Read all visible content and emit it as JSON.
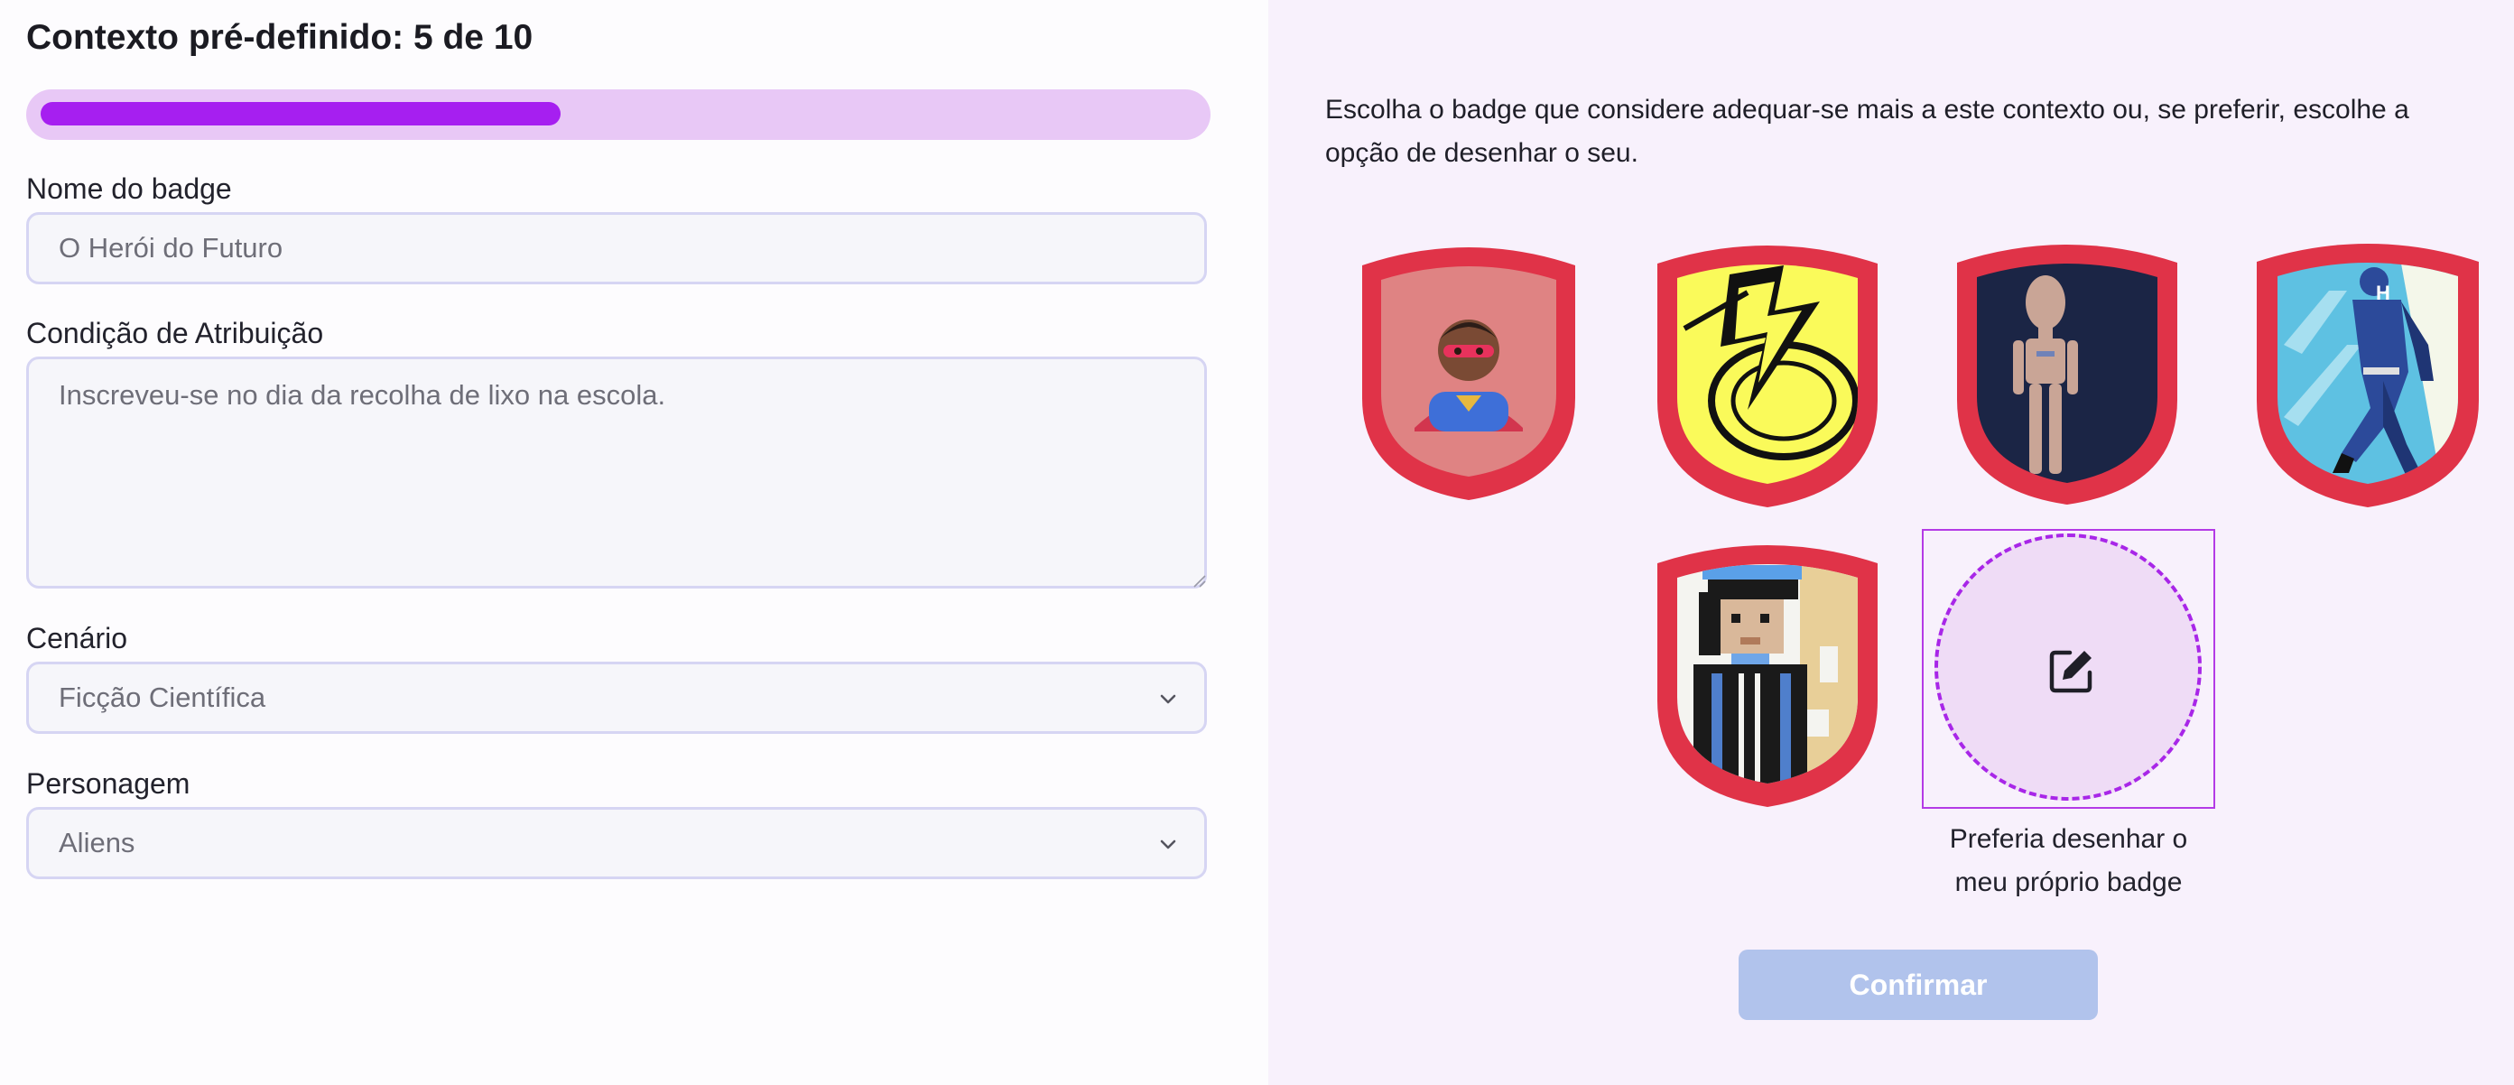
{
  "header": {
    "title": "Contexto pré-definido: 5 de 10",
    "progress": 0.45
  },
  "form": {
    "badge_name": {
      "label": "Nome do badge",
      "value": "O Herói do Futuro"
    },
    "condition": {
      "label": "Condição de Atribuição",
      "value": "Inscreveu-se no dia da recolha de lixo na escola."
    },
    "scenario": {
      "label": "Cenário",
      "value": "Ficção Científica"
    },
    "character": {
      "label": "Personagem",
      "value": "Aliens"
    }
  },
  "panel": {
    "intro": "Escolha o badge que considere adequar-se mais a este contexto ou, se preferir, escolhe a opção de desenhar o seu.",
    "badges": [
      {
        "name": "badge-superhero-emoji",
        "frame_color": "#e03348"
      },
      {
        "name": "badge-lightning-yellow",
        "frame_color": "#e03348"
      },
      {
        "name": "badge-robot-navy",
        "frame_color": "#e03348"
      },
      {
        "name": "badge-hero-blue",
        "frame_color": "#e03348"
      },
      {
        "name": "badge-pixel-astronaut",
        "frame_color": "#e03348"
      }
    ],
    "draw_option": {
      "caption_line1": "Preferia desenhar o",
      "caption_line2": "meu próprio badge",
      "icon": "edit-icon"
    },
    "confirm_label": "Confirmar"
  },
  "colors": {
    "accent": "#a61ff0",
    "progress_track": "#e8c8f6",
    "panel_bg": "#f8f1fc",
    "confirm_disabled": "#b1c3ec",
    "badge_frame": "#e03348"
  }
}
